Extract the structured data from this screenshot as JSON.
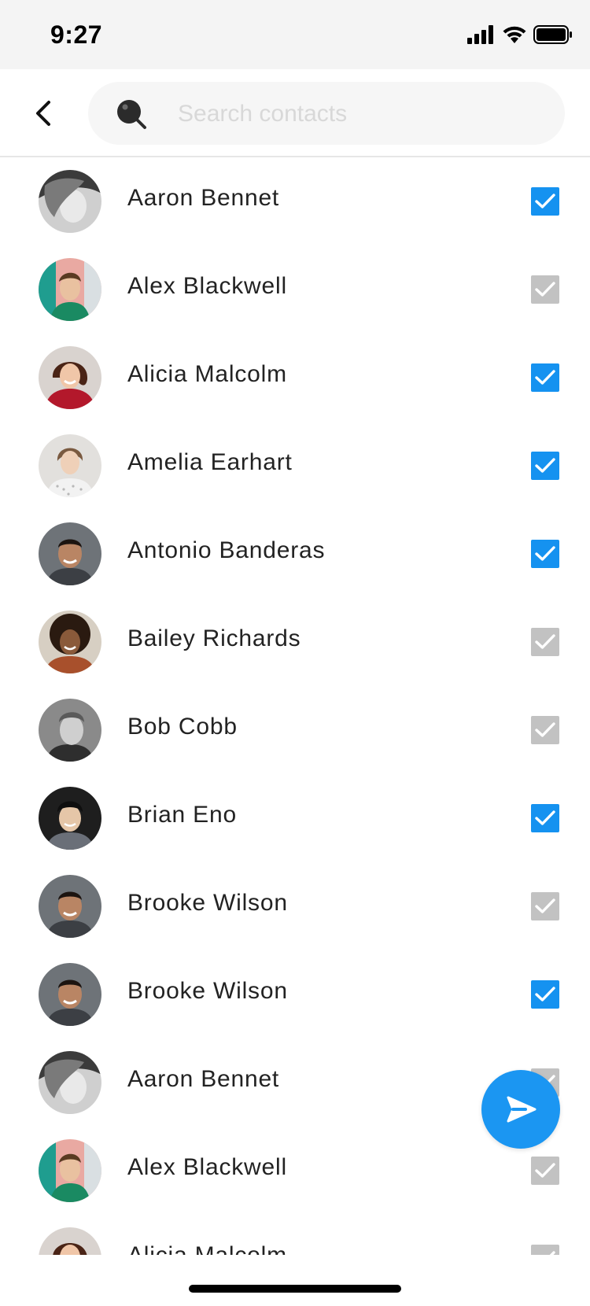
{
  "status_bar": {
    "time": "9:27"
  },
  "search": {
    "placeholder": "Search contacts",
    "value": ""
  },
  "icons": {
    "back": "chevron-left-icon",
    "search": "search-icon",
    "send": "send-icon",
    "check": "checkmark-icon"
  },
  "colors": {
    "accent": "#1592f0",
    "unchecked": "#c2c2c2",
    "fab": "#1b96f2"
  },
  "contacts": [
    {
      "name": "Aaron Bennet",
      "selected": true
    },
    {
      "name": "Alex Blackwell",
      "selected": false
    },
    {
      "name": "Alicia Malcolm",
      "selected": true
    },
    {
      "name": "Amelia Earhart",
      "selected": true
    },
    {
      "name": "Antonio Banderas",
      "selected": true
    },
    {
      "name": "Bailey Richards",
      "selected": false
    },
    {
      "name": "Bob Cobb",
      "selected": false
    },
    {
      "name": "Brian Eno",
      "selected": true
    },
    {
      "name": "Brooke Wilson",
      "selected": false
    },
    {
      "name": "Brooke Wilson",
      "selected": true
    },
    {
      "name": "Aaron Bennet",
      "selected": false
    },
    {
      "name": "Alex Blackwell",
      "selected": false
    },
    {
      "name": "Alicia Malcolm",
      "selected": false
    }
  ]
}
